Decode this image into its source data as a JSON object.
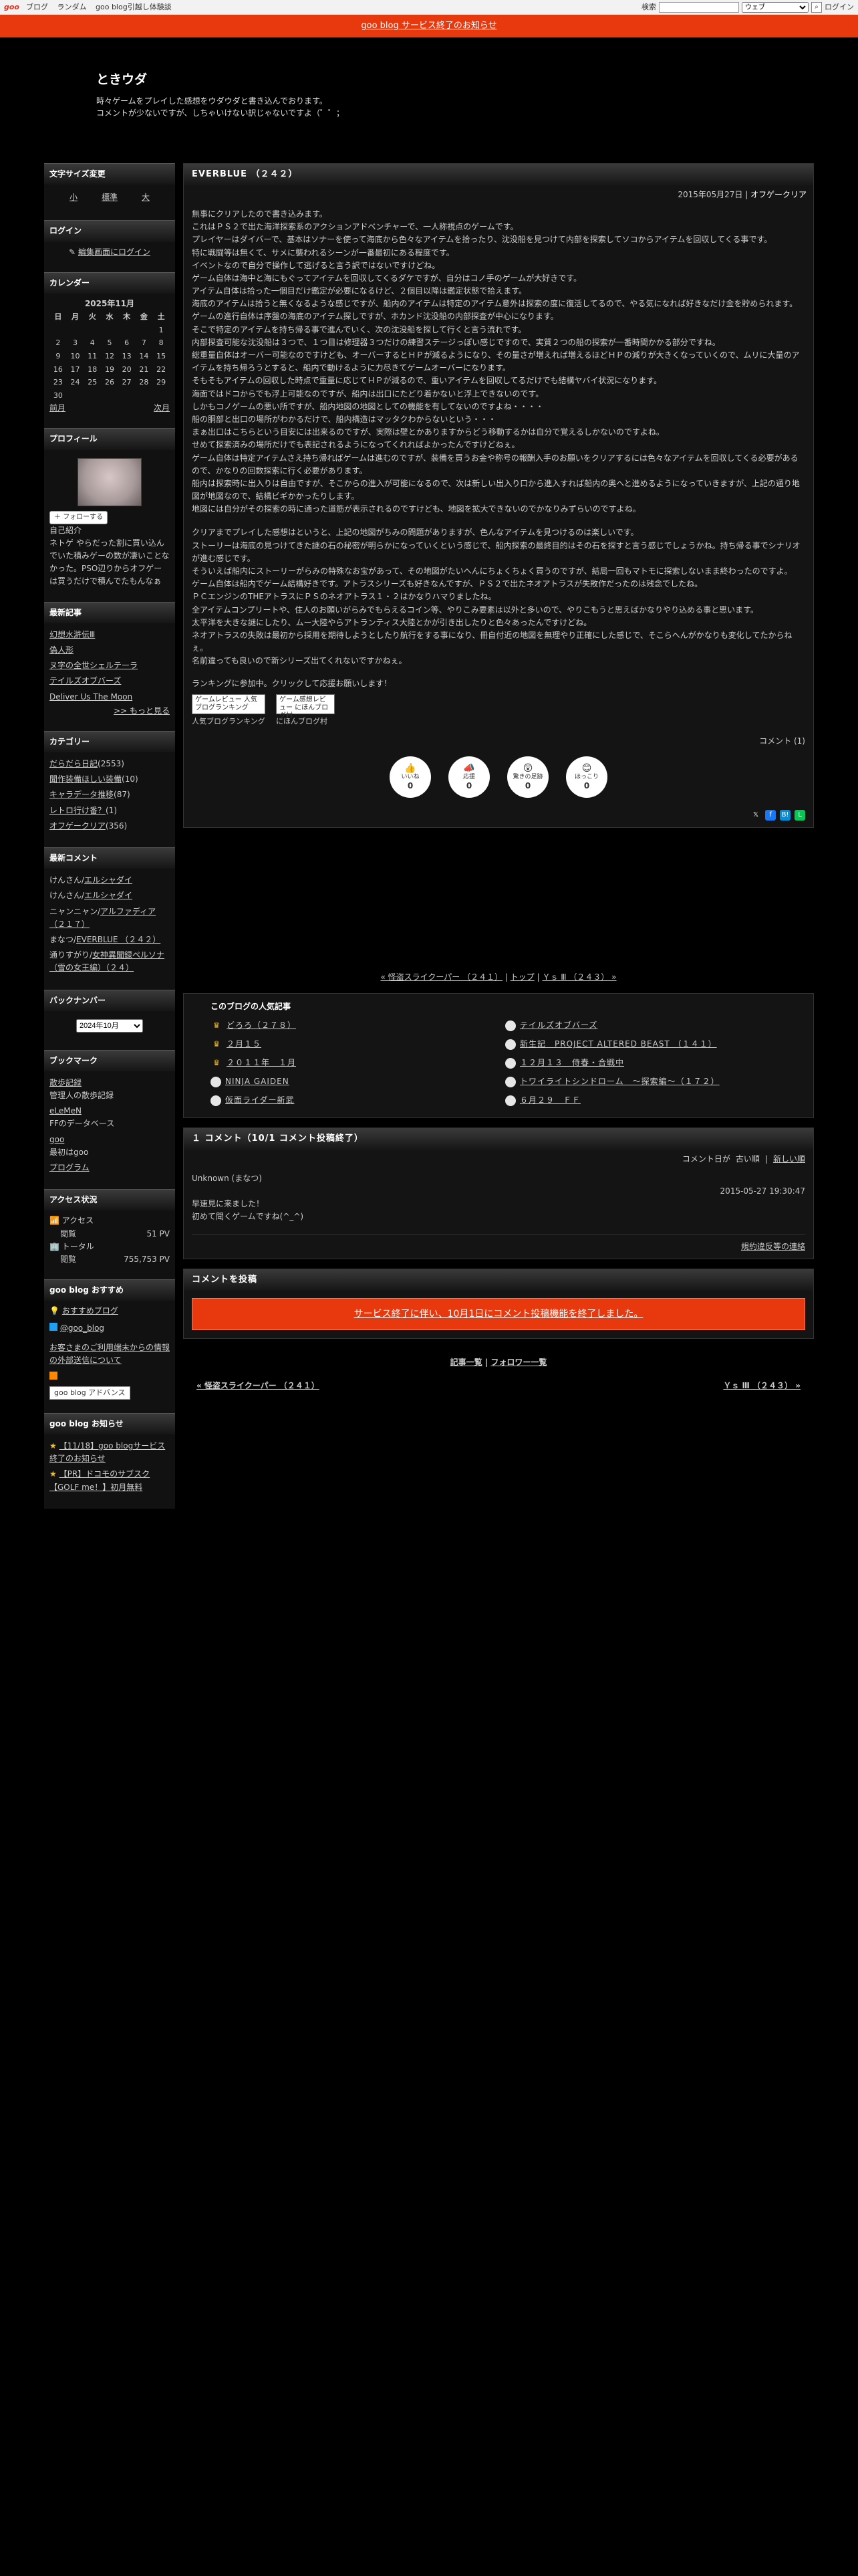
{
  "topbar": {
    "logo": "goo",
    "links": [
      "ブログ",
      "ランダム",
      "goo blog引越し体験談"
    ],
    "search_label": "検索",
    "search_scope": "ウェブ",
    "login": "ログイン"
  },
  "notice": "goo blog サービス終了のお知らせ",
  "blog": {
    "title": "ときウダ",
    "desc1": "時々ゲームをプレイした感想をウダウダと書き込んでおります。",
    "desc2": "コメントが少ないですが、しちゃいけない訳じゃないですよ（゜゜；"
  },
  "sidebar": {
    "fontsize": {
      "title": "文字サイズ変更",
      "small": "小",
      "medium": "標準",
      "large": "大"
    },
    "login": {
      "title": "ログイン",
      "link": "編集画面にログイン"
    },
    "calendar": {
      "title": "カレンダー",
      "month": "2025年11月",
      "days": [
        "日",
        "月",
        "火",
        "水",
        "木",
        "金",
        "土"
      ],
      "weeks": [
        [
          "",
          "",
          "",
          "",
          "",
          "",
          "1"
        ],
        [
          "2",
          "3",
          "4",
          "5",
          "6",
          "7",
          "8"
        ],
        [
          "9",
          "10",
          "11",
          "12",
          "13",
          "14",
          "15"
        ],
        [
          "16",
          "17",
          "18",
          "19",
          "20",
          "21",
          "22"
        ],
        [
          "23",
          "24",
          "25",
          "26",
          "27",
          "28",
          "29"
        ],
        [
          "30",
          "",
          "",
          "",
          "",
          "",
          ""
        ]
      ],
      "prev": "前月",
      "next": "次月"
    },
    "profile": {
      "title": "プロフィール",
      "follow": "フォローする",
      "intro_label": "自己紹介",
      "intro": "ネトゲ やらだった割に買い込んでいた積みゲーの数が凄いことなかった。PSO辺りからオフゲーは買うだけで積んでたもんなぁ"
    },
    "recent": {
      "title": "最新記事",
      "items": [
        "幻想水滸伝Ⅲ",
        "偽人形",
        "ヌ字の全世シェルテーラ",
        "テイルズオブバーズ",
        "Deliver Us The Moon"
      ],
      "more": ">> もっと見る"
    },
    "category": {
      "title": "カテゴリー",
      "items": [
        {
          "name": "だらだら日記",
          "count": "(2553)"
        },
        {
          "name": "聞作装備ほしい装備",
          "count": "(10)"
        },
        {
          "name": "キャラデータ推移",
          "count": "(87)"
        },
        {
          "name": "レトロ行け番？",
          "count": "(1)"
        },
        {
          "name": "オフゲークリア",
          "count": "(356)"
        }
      ]
    },
    "comments": {
      "title": "最新コメント",
      "items": [
        {
          "who": "けんさん/",
          "link": "エルシャダイ"
        },
        {
          "who": "けんさん/",
          "link": "エルシャダイ"
        },
        {
          "who": "ニャンニャン/",
          "link": "アルファディア （２１７）"
        },
        {
          "who": "まなつ/",
          "link": "EVERBLUE （２４２）"
        },
        {
          "who": "通りすがり/",
          "link": "女神異聞録ペルソナ（雪の女王編）（２４）"
        }
      ]
    },
    "archive": {
      "title": "バックナンバー",
      "selected": "2024年10月"
    },
    "bookmark": {
      "title": "ブックマーク",
      "items": [
        {
          "name": "散歩記録",
          "desc": "管理人の散歩記録"
        },
        {
          "name": "eLeMeN",
          "desc": "FFのデータベース"
        },
        {
          "name": "goo",
          "desc": "最初はgoo"
        },
        {
          "name": "プログラム",
          "desc": ""
        }
      ]
    },
    "access": {
      "title": "アクセス状況",
      "access_label": "アクセス",
      "view_label": "閲覧",
      "view_value": "51 PV",
      "total_label": "トータル",
      "total_value": "755,753 PV"
    },
    "recommend": {
      "title": "goo blog おすすめ",
      "link": "おすすめブログ",
      "twitter": "@goo_blog"
    },
    "misc": {
      "note": "お客さまのご利用端末からの情報の外部送信について",
      "advance": "goo blog アドバンス"
    },
    "news": {
      "title": "goo blog お知らせ",
      "items": [
        "【11/18】goo blogサービス終了のお知らせ",
        "【PR】ドコモのサブスク【GOLF me！】初月無料"
      ]
    }
  },
  "article": {
    "title": "EVERBLUE （２４２）",
    "date": "2015年05月27日",
    "category": "オフゲークリア",
    "paragraphs": [
      "無事にクリアしたので書き込みます。",
      "これはＰＳ２で出た海洋探索系のアクションアドベンチャーで、一人称視点のゲームです。",
      "プレイヤーはダイバーで、基本はソナーを使って海底から色々なアイテムを拾ったり、沈没船を見つけて内部を探索してソコからアイテムを回収してくる事です。",
      "特に戦闘等は無くて、サメに襲われるシーンが一番最初にある程度です。",
      "イベントなので自分で操作して逃げると言う訳ではないですけどね。",
      "ゲーム自体は海中と海にもぐってアイテムを回収してくるダケですが、自分はコノ手のゲームが大好きです。",
      "アイテム自体は拾った一個目だけ鑑定が必要になるけど、２個目以降は鑑定状態で拾えます。",
      "海底のアイテムは拾うと無くなるような感じですが、船内のアイテムは特定のアイテム意外は探索の度に復活してるので、やる気になれば好きなだけ金を貯められます。",
      "ゲームの進行自体は序盤の海底のアイテム探しですが、ホカンド沈没船の内部探査が中心になります。",
      "そこで特定のアイテムを持ち帰る事で進んでいく、次の沈没船を探して行くと言う流れです。",
      "内部探査可能な沈没船は３つで、１つ目は修理器３つだけの練習ステージっぽい感じですので、実質２つの船の探索が一番時間かかる部分ですね。",
      "総重量自体はオーバー可能なのですけども、オーバーするとＨＰが減るようになり、その量さが増えれば増えるほどＨＰの減りが大きくなっていくので、ムリに大量のアイテムを持ち帰ろうとすると、船内で動けるように力尽きてゲームオーバーになります。",
      "そもそもアイテムの回収した時点で重量に応じてＨＰが減るので、重いアイテムを回収してるだけでも結構ヤバイ状況になります。",
      "海面ではドコからでも浮上可能なのですが、船内は出口にたどり着かないと浮上できないのです。",
      "しかもコノゲームの悪い所ですが、船内地図の地図としての機能を有してないのですよね・・・・",
      "船の胴部と出口の場所がわかるだけで、船内構造はマッタクわからないという・・・",
      "まぁ出口はこちらという目安には出来るのですが、実際は壁とかありますからどう移動するかは自分で覚えるしかないのですよね。",
      "せめて探索済みの場所だけでも表記されるようになってくれればよかったんですけどねぇ。",
      "ゲーム自体は特定アイテムさえ持ち帰ればゲームは進むのですが、装備を買うお金や称号の報酬入手のお願いをクリアするには色々なアイテムを回収してくる必要があるので、かなりの回数探索に行く必要があります。",
      "船内は探索時に出入りは自由ですが、そこからの進入が可能になるので、次は新しい出入り口から進入すれば船内の奥へと進めるようになっていきますが、上記の通り地図が地図なので、結構ビギかかったりします。",
      "地図には自分がその探索の時に通った道筋が表示されるのですけども、地図を拡大できないのでかなりみずらいのですよね。",
      "",
      "クリアまでプレイした感想はというと、上記の地図がちみの問題がありますが、色んなアイテムを見つけるのは楽しいです。",
      "ストーリーは海底の見つけてきた謎の石の秘密が明らかになっていくという感じで、船内探索の最終目的はその石を探すと言う感じでしょうかね。持ち帰る事でシナリオが進む感じです。",
      "そういえば船内にストーリーがらみの特殊なお宝があって、その地図がたいへんにちょくちょく買うのですが、結局一回もマトモに探索しないまま終わったのですよ。",
      "ゲーム自体は船内でゲーム結構好きです。アトラスシリーズも好きなんですが、ＰＳ２で出たネオアトラスが失敗作だったのは残念でしたね。",
      "ＰＣエンジンのTHEアトラスにＰＳのネオアトラス１・２はかなりハマりましたね。",
      "全アイテムコンプリートや、住人のお願いがらみでもらえるコイン等、やりこみ要素は以外と多いので、やりこもうと思えばかなりやり込める事と思います。",
      "太平洋を大きな謎にしたり、ムー大陸やらアトランティス大陸とかが引き出したりと色々あったんですけどね。",
      "ネオアトラスの失敗は最初から採用を期待しようとしたり航行をする事になり、冊自付近の地図を無理やり正確にした感じで、そこらへんがかなりも変化してたからねぇ。",
      "名前違っても良いので新シリーズ出てくれないですかねぇ。"
    ],
    "rank_text": "ランキングに参加中。クリックして応援お願いします！",
    "rank_buttons": [
      {
        "img": "ゲームレビュー 人気ブログランキング",
        "label": "人気ブログランキング"
      },
      {
        "img": "ゲーム感想レビュー にほんブログ村",
        "label": "にほんブログ村"
      }
    ],
    "comment_count": "コメント (1)",
    "reactions": [
      {
        "name": "いいね",
        "emo": "👍",
        "label": "いいね",
        "count": "0"
      },
      {
        "name": "応援",
        "emo": "📣",
        "label": "応援",
        "count": "0"
      },
      {
        "name": "参考",
        "emo": "😲",
        "label": "驚きの足跡",
        "count": "0"
      },
      {
        "name": "ほっこり",
        "emo": "😊",
        "label": "ほっこり",
        "count": "0"
      }
    ]
  },
  "prevnext": {
    "prev": "« 怪盗スライクーパー （２４１）",
    "top": "トップ",
    "next": "Ｙｓ Ⅲ （２４３） »"
  },
  "popular": {
    "title": "このブログの人気記事",
    "left": [
      "どろろ（２７８）",
      "２月１５",
      "２０１１年　１月",
      "NINJA GAIDEN",
      "仮面ライダー新武"
    ],
    "right": [
      "テイルズオブバーズ",
      "新生記　PROJECT ALTERED BEAST （１４１）",
      "１２月１３　侍春・合戦中",
      "トワイライトシンドローム　～探索編～（１７２）",
      "６月２９　ＦＦ"
    ]
  },
  "comments": {
    "title": "１ コメント（10/1 コメント投稿終了）",
    "order_label": "コメント日が",
    "old": "古い順",
    "new": "新しい順",
    "items": [
      {
        "author": "Unknown (まなつ)",
        "date": "2015-05-27 19:30:47",
        "body1": "早速見に来ました！",
        "body2": "初めて聞くゲームですね(^_^)"
      }
    ],
    "spam": "規約違反等の連絡"
  },
  "post": {
    "title": "コメントを投稿",
    "end_notice": "サービス終了に伴い、10月1日にコメント投稿機能を終了しました。"
  },
  "footer": {
    "list": "記事一覧",
    "follow": "フォロワー一覧",
    "prev": "« 怪盗スライクーパー （２４１）",
    "next": "Ｙｓ Ⅲ （２４３） »"
  }
}
